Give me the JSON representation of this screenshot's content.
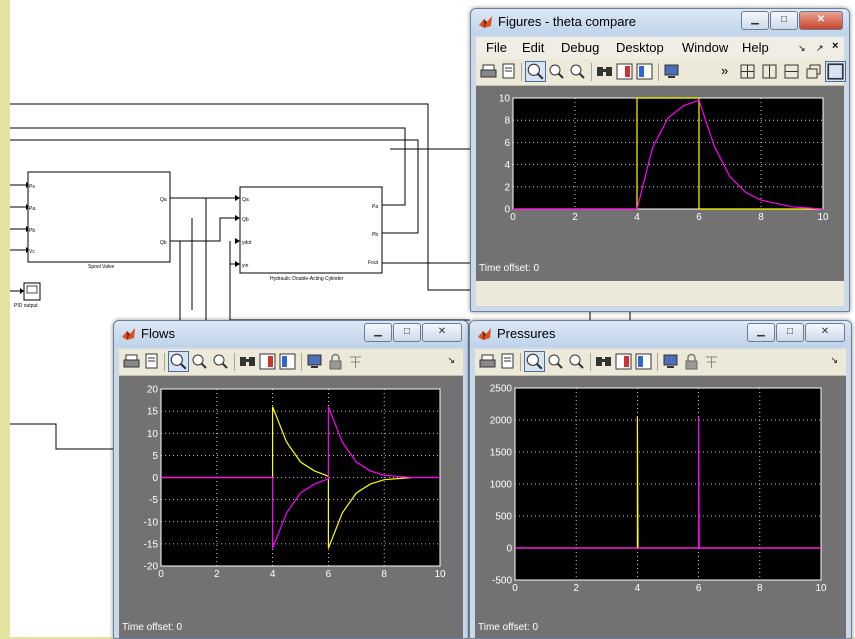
{
  "windows": {
    "theta": {
      "title": "Figures - theta compare",
      "menu": [
        "File",
        "Edit",
        "Debug",
        "Desktop",
        "Window",
        "Help"
      ],
      "time_offset": "Time offset:  0"
    },
    "flows": {
      "title": "Flows",
      "time_offset": "Time offset:  0"
    },
    "pressures": {
      "title": "Pressures",
      "time_offset": "Time offset:  0"
    }
  },
  "simulink": {
    "blocks": {
      "spool_valve": {
        "label": "Spool Valve",
        "ports_in": [
          "Ps",
          "Pa",
          "Pb",
          "Vc"
        ],
        "ports_out": [
          "Qa",
          "Qb"
        ]
      },
      "cylinder": {
        "label": "Hydraulic Double-Acting Cylinder",
        "ports_in": [
          "Qa",
          "Qb",
          "ydot",
          "yin"
        ],
        "ports_out": [
          "Pa",
          "Pb",
          "Fout"
        ]
      },
      "pid_output": {
        "label": "PID output"
      }
    }
  },
  "colors": {
    "yellow": "#ffff00",
    "magenta": "#ff00ff",
    "plot_bg": "#000000",
    "frame_bg": "#727272"
  },
  "chart_data": [
    {
      "type": "line",
      "xlim": [
        0,
        10
      ],
      "ylim": [
        0,
        10
      ],
      "xticks": [
        0,
        2,
        4,
        6,
        8,
        10
      ],
      "yticks": [
        0,
        2,
        4,
        6,
        8,
        10
      ],
      "grid": true,
      "series": [
        {
          "color": "yellow",
          "x": [
            0,
            4,
            4,
            6,
            6,
            10
          ],
          "y": [
            0,
            0,
            10,
            10,
            0,
            0
          ]
        },
        {
          "color": "magenta",
          "x": [
            0,
            4,
            4.5,
            5,
            5.5,
            6,
            6.5,
            7,
            7.5,
            8,
            9,
            10
          ],
          "y": [
            0,
            0,
            5.5,
            8.2,
            9.3,
            9.8,
            5.6,
            2.9,
            1.5,
            0.8,
            0.2,
            0
          ]
        }
      ]
    },
    {
      "type": "line",
      "xlim": [
        0,
        10
      ],
      "ylim": [
        -20,
        20
      ],
      "xticks": [
        0,
        2,
        4,
        6,
        8,
        10
      ],
      "yticks": [
        -20,
        -15,
        -10,
        -5,
        0,
        5,
        10,
        15,
        20
      ],
      "grid": true,
      "series": [
        {
          "color": "yellow",
          "x": [
            0,
            4,
            4,
            4.5,
            5,
            5.5,
            6,
            6,
            6.5,
            7,
            7.5,
            8,
            9
          ],
          "y": [
            0,
            0,
            16,
            8,
            3.5,
            1.5,
            0.3,
            -16,
            -8,
            -3.5,
            -1.5,
            -0.5,
            0
          ]
        },
        {
          "color": "magenta",
          "x": [
            0,
            4,
            4,
            4.5,
            5,
            5.5,
            6,
            6,
            6.5,
            7,
            7.5,
            8,
            9,
            10
          ],
          "y": [
            0,
            0,
            -16,
            -8,
            -3.5,
            -1.5,
            -0.3,
            16,
            8,
            3.5,
            1.5,
            0.5,
            0,
            0
          ]
        }
      ]
    },
    {
      "type": "line",
      "xlim": [
        0,
        10
      ],
      "ylim": [
        -500,
        2500
      ],
      "xticks": [
        0,
        2,
        4,
        6,
        8,
        10
      ],
      "yticks": [
        -500,
        0,
        500,
        1000,
        1500,
        2000,
        2500
      ],
      "grid": true,
      "series": [
        {
          "color": "yellow",
          "x": [
            0,
            4,
            4,
            4.02,
            6,
            6,
            10
          ],
          "y": [
            0,
            0,
            2050,
            0,
            0,
            0,
            0
          ]
        },
        {
          "color": "magenta",
          "x": [
            0,
            6,
            6,
            6.02,
            10
          ],
          "y": [
            0,
            0,
            2050,
            0,
            0
          ]
        }
      ]
    }
  ]
}
